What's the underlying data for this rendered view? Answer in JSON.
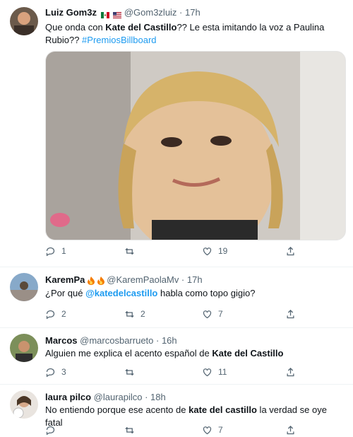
{
  "tweets": [
    {
      "name": "Luiz Gom3z",
      "handle": "@Gom3zluiz · 17h",
      "text_parts": [
        "Que onda con ",
        "Kate del Castillo",
        "?? Le esta imitando la voz a Paulina Rubio?? ",
        "#PremiosBillboard"
      ],
      "replies": "1",
      "retweets": "",
      "likes": "19"
    },
    {
      "name": "KaremPa",
      "handle": "@KaremPaolaMv · 17h",
      "text_parts": [
        "¿Por qué ",
        "@katedelcastillo",
        " habla como topo gigio?"
      ],
      "replies": "2",
      "retweets": "2",
      "likes": "7"
    },
    {
      "name": "Marcos",
      "handle": "@marcosbarrueto · 16h",
      "text_parts": [
        "Alguien me explica el acento español de ",
        "Kate del Castillo"
      ],
      "replies": "3",
      "retweets": "",
      "likes": "11"
    },
    {
      "name": "laura pilco",
      "handle": "@laurapilco · 18h",
      "text_parts": [
        "No entiendo porque ese acento de ",
        "kate del castillo",
        " la verdad se oye fatal"
      ],
      "replies": "",
      "retweets": "",
      "likes": "7"
    }
  ],
  "colors": {
    "link": "#1d9bf0",
    "muted": "#536471",
    "divider": "#eff3f4"
  },
  "icons": [
    "reply-icon",
    "retweet-icon",
    "like-icon",
    "share-icon",
    "mexico-flag-icon",
    "usa-flag-icon",
    "fire-icon"
  ]
}
